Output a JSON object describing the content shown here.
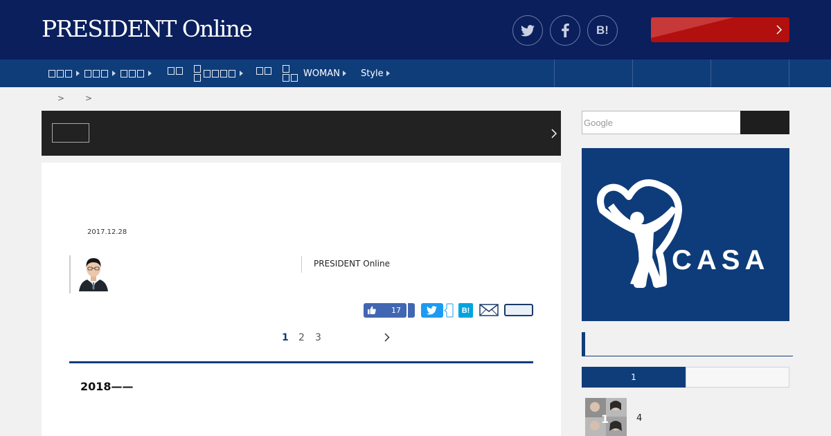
{
  "header": {
    "logo": "PRESIDENT Online",
    "social": [
      {
        "name": "twitter",
        "icon": "twitter-icon"
      },
      {
        "name": "facebook",
        "icon": "facebook-icon"
      },
      {
        "name": "hatena",
        "icon": "hatena-bookmark-icon",
        "label": "B!"
      }
    ],
    "cta_label": ""
  },
  "nav": {
    "items": [
      "",
      "",
      "",
      "",
      "",
      "",
      "WOMAN",
      "Style"
    ],
    "right_tabs": [
      "",
      "",
      ""
    ]
  },
  "breadcrumb": {
    "separator": ">"
  },
  "article": {
    "date": "2017.12.28",
    "source": "PRESIDENT Online",
    "like_count": "17",
    "hatena_label": "B!",
    "pager": {
      "pages": [
        "1",
        "2",
        "3"
      ],
      "current": "1"
    },
    "lead": "2018——"
  },
  "sidebar": {
    "search_placeholder": "Google",
    "ad_brand": "CASA",
    "ad_registered": "®",
    "ranking_tabs": [
      "1",
      ""
    ],
    "ranking_first": {
      "rank": "1",
      "text": "4"
    }
  },
  "colors": {
    "header_bg": "#0a1f5c",
    "nav_bg": "#0f3d7a",
    "cta_red": "#b20f0f",
    "ad_bg": "#0e3c7a"
  }
}
